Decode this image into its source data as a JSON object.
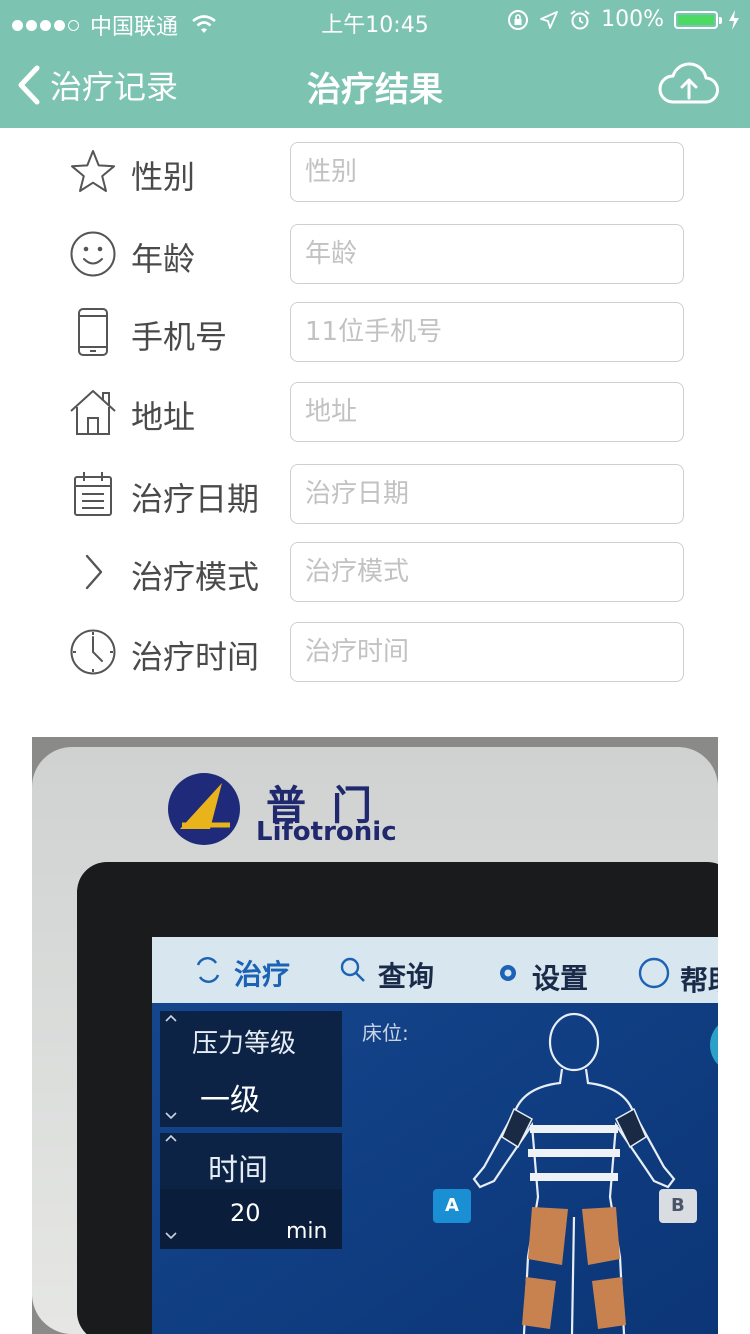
{
  "status_bar": {
    "carrier": "中国联通",
    "time": "上午10:45",
    "battery": "100%"
  },
  "nav": {
    "back_label": "治疗记录",
    "title": "治疗结果",
    "upload_icon": "cloud-upload-icon"
  },
  "form": {
    "rows": [
      {
        "icon": "star-icon",
        "label": "性别",
        "placeholder": "性别",
        "value": ""
      },
      {
        "icon": "smiley-icon",
        "label": "年龄",
        "placeholder": "年龄",
        "value": ""
      },
      {
        "icon": "phone-icon",
        "label": "手机号",
        "placeholder": "11位手机号",
        "value": ""
      },
      {
        "icon": "home-icon",
        "label": "地址",
        "placeholder": "地址",
        "value": ""
      },
      {
        "icon": "calendar-icon",
        "label": "治疗日期",
        "placeholder": "治疗日期",
        "value": ""
      },
      {
        "icon": "chevron-right-icon",
        "label": "治疗模式",
        "placeholder": "治疗模式",
        "value": ""
      },
      {
        "icon": "clock-icon",
        "label": "治疗时间",
        "placeholder": "治疗时间",
        "value": ""
      }
    ]
  },
  "photo": {
    "brand_cn": "普 门",
    "brand_en": "Lifotronic",
    "screen_tabs": [
      "治疗",
      "查询",
      "设置",
      "帮助"
    ],
    "pressure_label": "压力等级",
    "pressure_value": "一级",
    "time_label": "时间",
    "time_value": "20",
    "time_unit": "min",
    "bed_label": "床位:",
    "zone_a": "A",
    "zone_b": "B"
  },
  "colors": {
    "header_bg": "#7cc3b1",
    "battery_green": "#4cd964",
    "device_screen": "#0f3f86"
  }
}
